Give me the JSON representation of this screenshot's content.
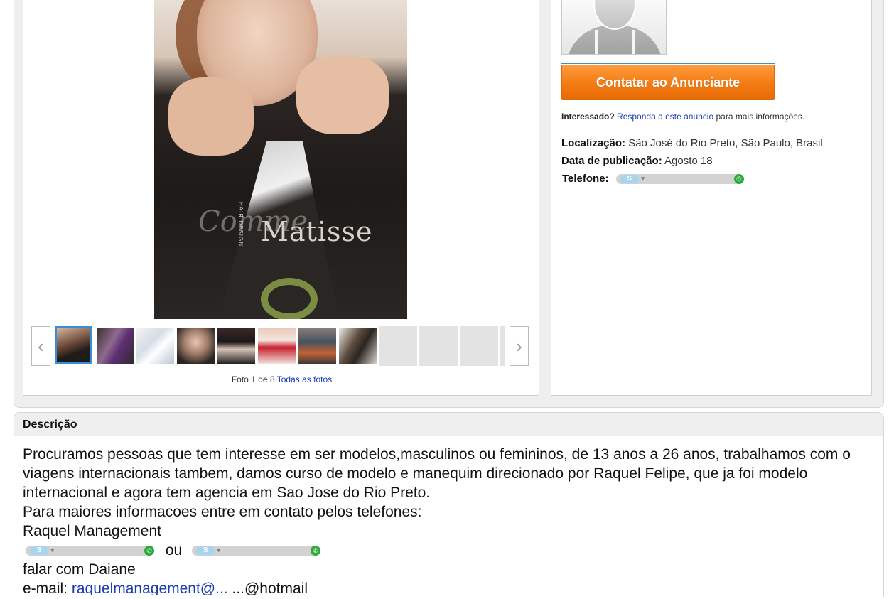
{
  "photo": {
    "title_text": "Matisse",
    "script_text": "Comme",
    "sub_text": "HAIR DESIGN"
  },
  "gallery": {
    "prev_arrow": "‹",
    "next_arrow": "›",
    "counter_prefix": "Foto",
    "current": "1",
    "de": "de",
    "total": "8",
    "all_photos_link": "Todas as fotos"
  },
  "seller": {
    "contact_button": "Contatar ao Anunciante",
    "interest_label": "Interessado?",
    "respond_link": "Responda a este anúncio",
    "interest_suffix": "para mais informações."
  },
  "details": {
    "location_label": "Localização:",
    "location_value": "São José do Rio Preto, São Paulo, Brasil",
    "date_label": "Data de publicação:",
    "date_value": "Agosto 18",
    "phone_label": "Telefone:"
  },
  "description": {
    "heading": "Descrição",
    "paragraph": "Procuramos pessoas que tem interesse em ser modelos,masculinos ou femininos, de 13 anos a 26 anos, trabalhamos com o viagens internacionais tambem, damos curso de modelo e manequim direcionado por Raquel Felipe, que ja foi modelo internacional e agora tem agencia em Sao Jose do Rio Preto.",
    "line_contact": "Para maiores informacoes entre em contato pelos telefones:",
    "line_name": "Raquel Management",
    "or_word": "ou",
    "line_daiane": "falar com Daiane",
    "email_prefix": "e-mail:",
    "email_link": "raquelmanagement@...",
    "email_rest": "...@hotmail"
  },
  "colors": {
    "accent_orange": "#f37c12",
    "link_blue": "#1a3bb3",
    "selected_thumb_border": "#3a8dd8"
  }
}
